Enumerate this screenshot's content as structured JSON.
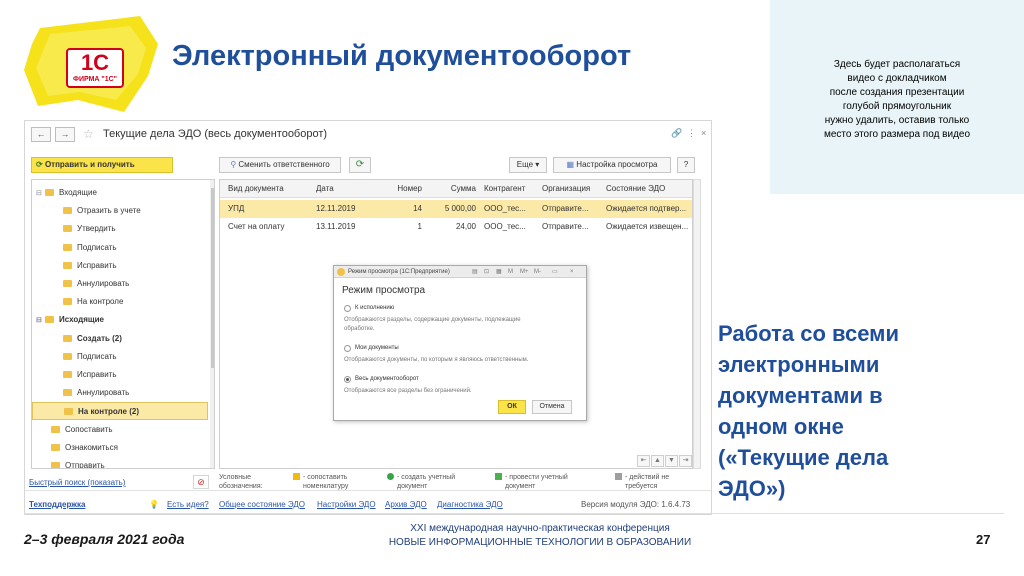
{
  "slide": {
    "title": "Электронный документооборот",
    "logo": {
      "text_main": "1С",
      "text_sub": "ФИРМА \"1С\""
    },
    "video_placeholder": [
      "Здесь будет располагаться",
      "видео с докладчиком",
      "после создания презентации",
      "голубой прямоугольник",
      "нужно удалить, оставив только",
      "место этого размера под видео"
    ],
    "side_text": [
      "Работа со всеми",
      "электронными",
      "документами в",
      "одном окне",
      "(«Текущие дела",
      "ЭДО»)"
    ],
    "footer": {
      "date": "2–3 февраля 2021 года",
      "conference_line1": "XXI международная научно-практическая конференция",
      "conference_line2": "НОВЫЕ ИНФОРМАЦИОННЫЕ ТЕХНОЛОГИИ В ОБРАЗОВАНИИ",
      "page_number": "27"
    },
    "colors": {
      "title": "#1f4e9a",
      "accent_yellow": "#fbe34a",
      "video_bg": "#e8f4f7"
    }
  },
  "app": {
    "nav_back": "←",
    "nav_forward": "→",
    "title": "Текущие дела ЭДО (весь документооборот)",
    "window_controls": {
      "link": "🔗",
      "more": "⋮",
      "close": "×"
    },
    "toolbar": {
      "send_receive": "Отправить и получить",
      "change_responsible": "Сменить ответственного",
      "refresh": "⟳",
      "more": "Еще ▾",
      "view_settings": "Настройка просмотра",
      "help": "?"
    },
    "tree": [
      {
        "label": "Входящие",
        "bold": false,
        "expander": "⊟"
      },
      {
        "label": "Отразить в учете",
        "bold": false,
        "expander": ""
      },
      {
        "label": "Утвердить",
        "bold": false,
        "expander": ""
      },
      {
        "label": "Подписать",
        "bold": false,
        "expander": ""
      },
      {
        "label": "Исправить",
        "bold": false,
        "expander": ""
      },
      {
        "label": "Аннулировать",
        "bold": false,
        "expander": ""
      },
      {
        "label": "На контроле",
        "bold": false,
        "expander": ""
      },
      {
        "label": "Исходящие",
        "bold": true,
        "expander": "⊟"
      },
      {
        "label": "Создать (2)",
        "bold": true,
        "expander": ""
      },
      {
        "label": "Подписать",
        "bold": false,
        "expander": ""
      },
      {
        "label": "Исправить",
        "bold": false,
        "expander": ""
      },
      {
        "label": "Аннулировать",
        "bold": false,
        "expander": ""
      },
      {
        "label": "На контроле (2)",
        "bold": true,
        "expander": ""
      },
      {
        "label": "Сопоставить",
        "bold": false,
        "expander": ""
      },
      {
        "label": "Ознакомиться",
        "bold": false,
        "expander": ""
      },
      {
        "label": "Отправить",
        "bold": false,
        "expander": ""
      }
    ],
    "selected_tree_index": 12,
    "table": {
      "columns": [
        "Вид документа",
        "Дата",
        "Номер",
        "Сумма",
        "Контрагент",
        "Организация",
        "Состояние ЭДО"
      ],
      "rows": [
        [
          "УПД",
          "12.11.2019",
          "14",
          "5 000,00",
          "ООО_тес...",
          "Отправите...",
          "Ожидается подтвер..."
        ],
        [
          "Счет на оплату",
          "13.11.2019",
          "1",
          "24,00",
          "ООО_тес...",
          "Отправите...",
          "Ожидается извещен..."
        ]
      ]
    },
    "pager": [
      "⇤",
      "▲",
      "▼",
      "⇥"
    ],
    "dialog": {
      "bar_title": "Режим просмотра  (1С:Предприятие)",
      "bar_controls": [
        "▤",
        "⊡",
        "▦",
        "M",
        "M+",
        "M-",
        "▭",
        "×"
      ],
      "title": "Режим просмотра",
      "options": [
        {
          "label": "К исполнению",
          "hint": [
            "Отображаются разделы, содержащие документы, подлежащие",
            "обработке."
          ],
          "checked": false
        },
        {
          "label": "Мои документы",
          "hint": [
            "Отображаются документы, по которым я являюсь ответственным."
          ],
          "checked": false
        },
        {
          "label": "Весь документооборот",
          "hint": [
            "Отображаются все разделы без ограничений."
          ],
          "checked": true
        }
      ],
      "ok": "ОК",
      "cancel": "Отмена"
    },
    "legend": {
      "caption": [
        "Условные",
        "обозначения:"
      ],
      "items": [
        {
          "icon": "warning-icon",
          "color": "#f2b90c",
          "text": [
            "- сопоставить",
            "номенклатуру"
          ]
        },
        {
          "icon": "plus-circle-icon",
          "color": "#3aa34a",
          "text": [
            "- создать учетный",
            "документ"
          ]
        },
        {
          "icon": "document-post-icon",
          "color": "#4caf50",
          "text": [
            "- провести учетный",
            "документ"
          ]
        },
        {
          "icon": "no-action-icon",
          "color": "#9e9e9e",
          "text": [
            "- действий не",
            "требуется"
          ]
        }
      ]
    },
    "bottom": {
      "quick_search": "Быстрый поиск (показать)",
      "support": "Техподдержка",
      "idea_link": "Есть идея?",
      "links": [
        "Общее состояние ЭДО",
        "Настройки ЭДО",
        "Архив ЭДО",
        "Диагностика ЭДО"
      ],
      "version": "Версия модуля ЭДО: 1.6.4.73"
    }
  }
}
